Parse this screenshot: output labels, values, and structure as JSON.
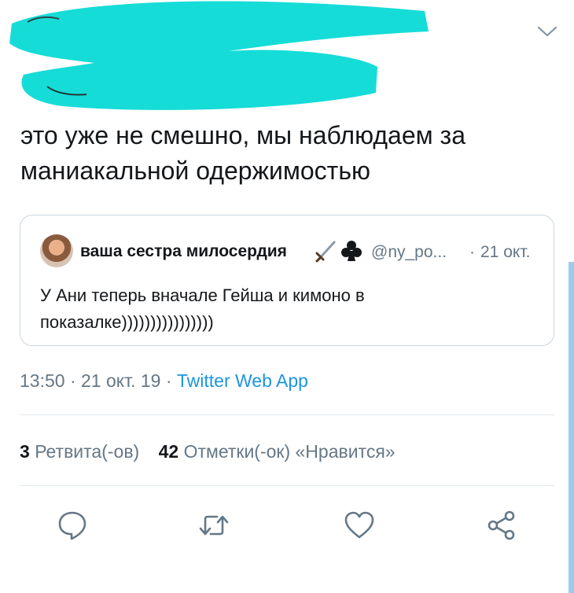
{
  "tweet": {
    "text": "это уже не смешно, мы наблюдаем за маниакальной одержимостью",
    "timestamp": "13:50 · 21 окт. 19",
    "source_sep": " · ",
    "source": "Twitter Web App"
  },
  "quoted_tweet": {
    "author_name": "ваша сестра милосердия",
    "emojis": [
      "dagger-emoji",
      "club-suit-emoji"
    ],
    "handle": "@ny_po...",
    "time_sep": "·",
    "time": "21 окт.",
    "text": "У Ани теперь вначале Гейша и кимоно в показалке))))))))))))))))"
  },
  "stats": {
    "retweets_count": "3",
    "retweets_label": "Ретвита(-ов)",
    "likes_count": "42",
    "likes_label": "Отметки(-ок) «Нравится»"
  },
  "actions": [
    "reply-icon",
    "retweet-icon",
    "like-icon",
    "share-icon"
  ],
  "menu_icon": "chevron-down-icon",
  "colors": {
    "text": "#14171a",
    "secondary": "#657786",
    "link": "#1b95e0",
    "border": "#ccd6dd",
    "scribble": "#16dcd8",
    "scrollbar": "#9ccbf2"
  }
}
